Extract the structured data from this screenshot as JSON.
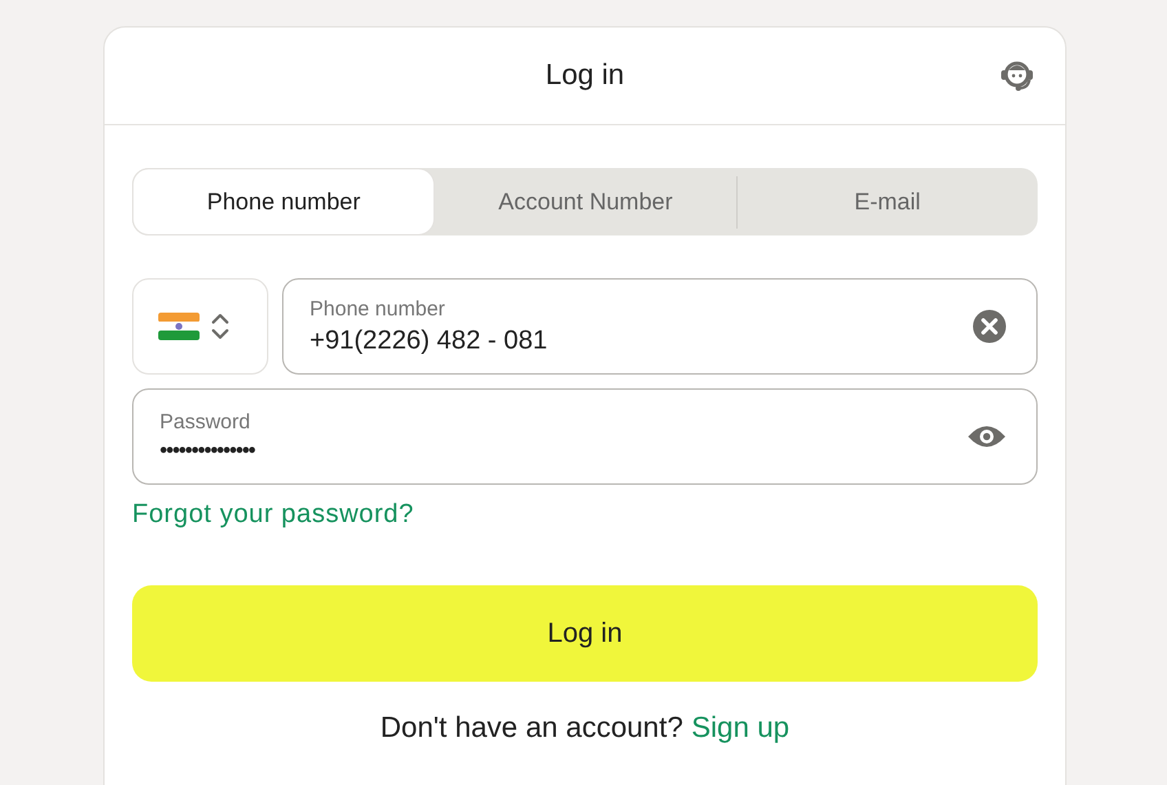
{
  "header": {
    "title": "Log in"
  },
  "tabs": [
    {
      "label": "Phone number",
      "selected": true
    },
    {
      "label": "Account Number",
      "selected": false
    },
    {
      "label": "E-mail",
      "selected": false
    }
  ],
  "phone": {
    "label": "Phone number",
    "value": "+91(2226) 482 - 081"
  },
  "password": {
    "label": "Password",
    "value": "•••••••••••••••"
  },
  "forgot_link": "Forgot your password?",
  "submit": "Log in",
  "footer": {
    "text": "Don't have an account?",
    "link": "Sign up"
  }
}
